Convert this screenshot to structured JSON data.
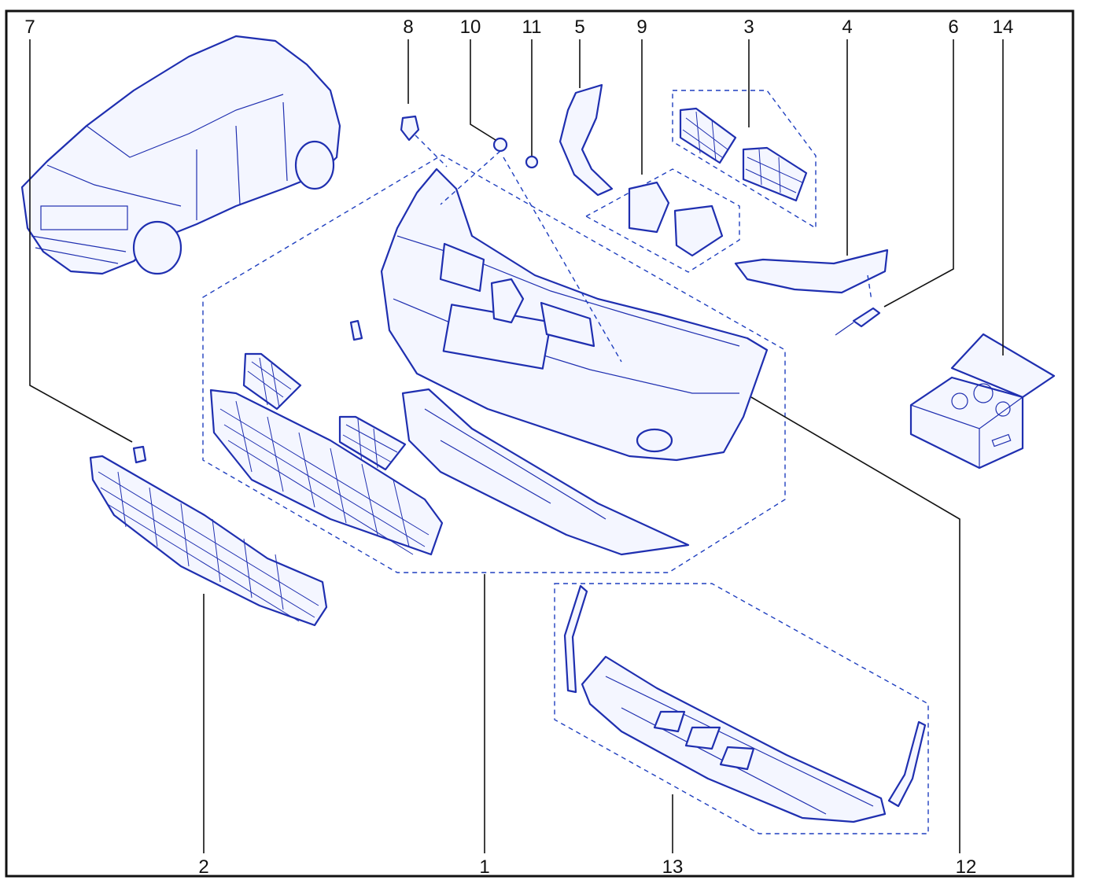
{
  "diagram": {
    "line_color": "#1f2fb0",
    "callout_color": "#111111",
    "callouts": [
      {
        "id": "c7",
        "label": "7"
      },
      {
        "id": "c8",
        "label": "8"
      },
      {
        "id": "c10",
        "label": "10"
      },
      {
        "id": "c11",
        "label": "11"
      },
      {
        "id": "c5",
        "label": "5"
      },
      {
        "id": "c9",
        "label": "9"
      },
      {
        "id": "c3",
        "label": "3"
      },
      {
        "id": "c4",
        "label": "4"
      },
      {
        "id": "c6",
        "label": "6"
      },
      {
        "id": "c14",
        "label": "14"
      },
      {
        "id": "c2",
        "label": "2"
      },
      {
        "id": "c1",
        "label": "1"
      },
      {
        "id": "c13",
        "label": "13"
      },
      {
        "id": "c12",
        "label": "12"
      }
    ]
  }
}
